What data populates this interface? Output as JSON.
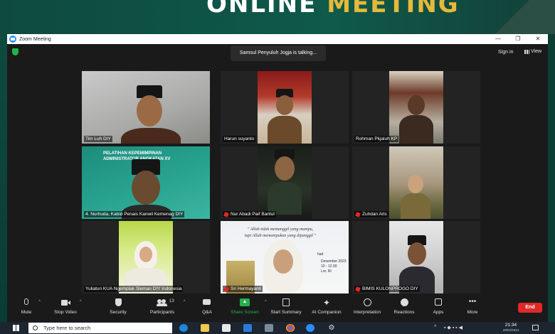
{
  "banner": {
    "word1": "ONLINE",
    "word2": "MEETING"
  },
  "window": {
    "title": "Zoom Meeting",
    "controls": [
      "—",
      "❐",
      "✕"
    ]
  },
  "topbar": {
    "talking": "Samsul Penyuluh Jogja is talking...",
    "signin": "Sign in",
    "view": "View"
  },
  "participants": [
    {
      "name": "Tim Luh DIY",
      "muted": false
    },
    {
      "name": "Harun suyanto",
      "muted": false
    },
    {
      "name": "Rohman Pkjaluh KP",
      "muted": false
    },
    {
      "name": "4. Nurhuda, Kabid Penais Kanwil Kemenag DIY",
      "muted": false
    },
    {
      "name": "Nur Abadi Paif Bantul",
      "muted": true
    },
    {
      "name": "Zuhdan Aris",
      "muted": true
    },
    {
      "name": "Yuliatun KUA Ngemplak Sleman DIY Indonesia",
      "muted": false
    },
    {
      "name": "Sri Hermayanti",
      "muted": true
    },
    {
      "name": "BIMIS KULONPROGO DIY",
      "muted": true
    }
  ],
  "slide": {
    "line1": "PELATIHAN KEPEMIMPINAN",
    "line2": "ADMINISTRATOR ANGKATAN XV"
  },
  "quote": {
    "line1": "\" Allah tidak memanggil yang mampu,",
    "line2": "tapi Allah memampukan yang dipanggil \"",
    "fragment1": "Desember 2023",
    "fragment2": "10 - 12.00",
    "fragment3": "Lor, RI",
    "fragment4": "had"
  },
  "toolbar": {
    "mute": "Mute",
    "video": "Stop Video",
    "security": "Security",
    "participants": "Participants",
    "participants_count": "13",
    "qa": "Q&A",
    "share": "Share Screen",
    "summary": "Start Summary",
    "ai": "AI Companion",
    "interpretation": "Interpretation",
    "reactions": "Reactions",
    "apps": "Apps",
    "more": "More",
    "end": "End"
  },
  "taskbar": {
    "search_placeholder": "Type here to search",
    "time": "21:34",
    "date": "29/02/2024"
  },
  "colors": {
    "end": "#e02828",
    "share": "#22b24c",
    "zoom_blue": "#2d8cff",
    "accent_gold": "#e6b93a"
  }
}
